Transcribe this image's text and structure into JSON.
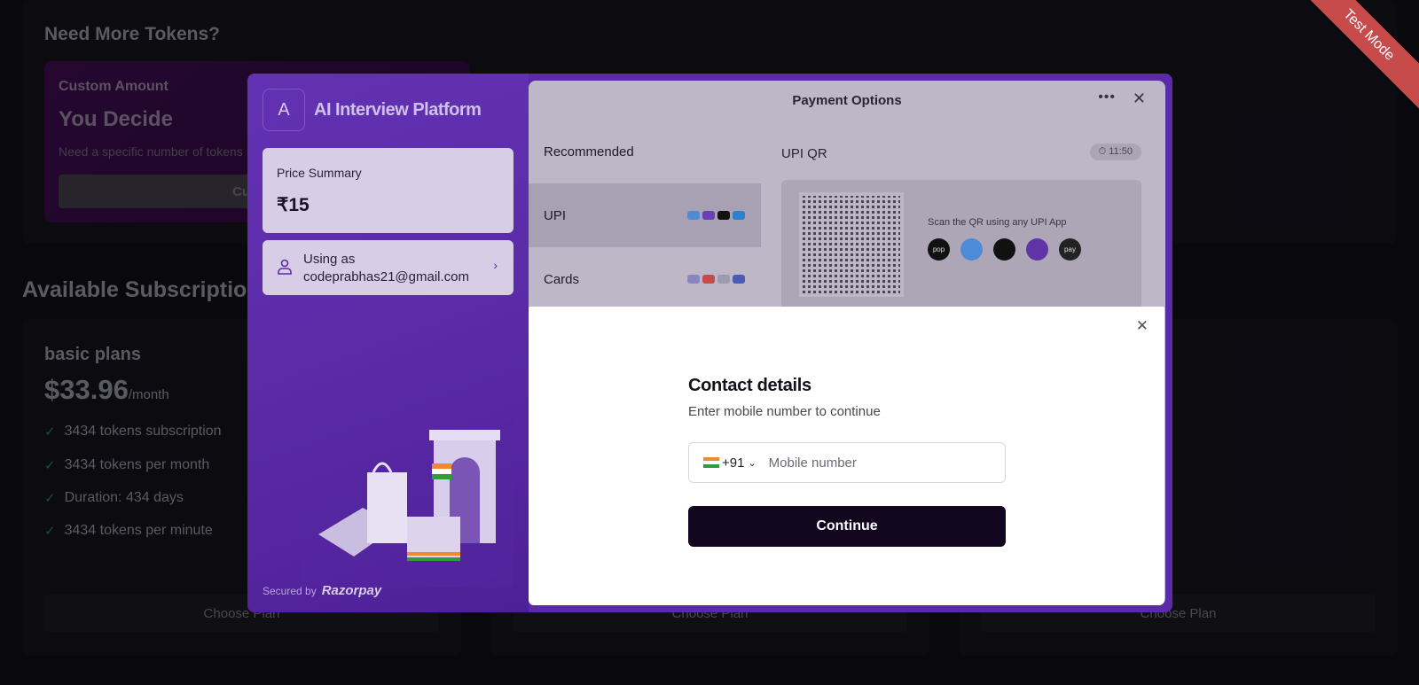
{
  "background": {
    "tokens_title": "Need More Tokens?",
    "custom": {
      "label": "Custom Amount",
      "heading": "You Decide",
      "description": "Need a specific number of tokens",
      "button": "Custom"
    },
    "subscriptions_title": "Available Subscriptions",
    "plans": [
      {
        "name": "basic plans",
        "price": "$33.96",
        "period": "/month",
        "features": [
          "3434 tokens subscription",
          "3434 tokens per month",
          "Duration: 434 days",
          "3434 tokens per minute"
        ],
        "button": "Choose Plan"
      },
      {
        "button": "Choose Plan"
      },
      {
        "button": "Choose Plan"
      }
    ]
  },
  "ribbon": "Test Mode",
  "razorpay": {
    "logo_letter": "A",
    "brand": "AI Interview Platform",
    "price_summary_label": "Price Summary",
    "price": "₹15",
    "using_as_line1": "Using as",
    "using_as_line2": "codeprabhas21@gmail.com",
    "secured_by": "Secured by",
    "razorpay_logo": "Razorpay",
    "payment_options_title": "Payment Options",
    "recommended": "Recommended",
    "methods": [
      "UPI",
      "Cards"
    ],
    "qr_title": "UPI QR",
    "timer": "11:50",
    "qr_scan_text": "Scan the QR using any UPI App",
    "upi_apps": [
      "pop",
      "gpay",
      "cred",
      "phonepe",
      "pay"
    ]
  },
  "contact": {
    "title": "Contact details",
    "subtitle": "Enter mobile number to continue",
    "country_code": "+91",
    "mobile_placeholder": "Mobile number",
    "mobile_value": "",
    "continue_label": "Continue"
  }
}
